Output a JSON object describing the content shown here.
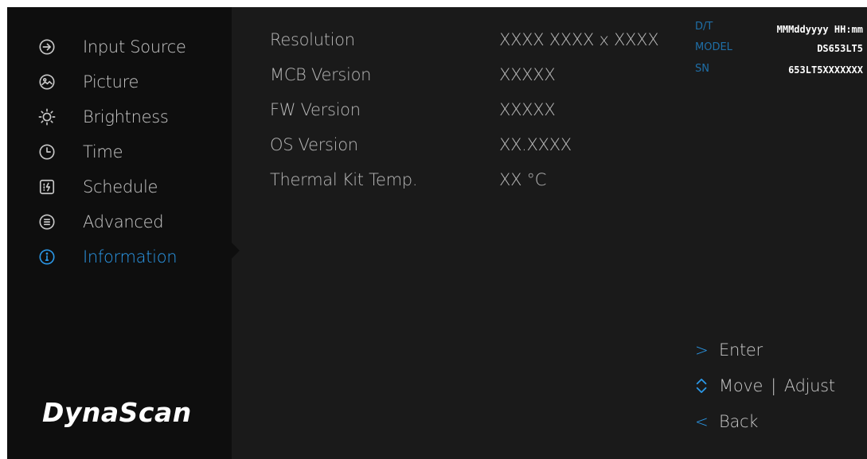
{
  "brand": {
    "logo_text": "DynaScan"
  },
  "sidebar": {
    "items": [
      {
        "label": "Input Source",
        "icon": "input-source-icon"
      },
      {
        "label": "Picture",
        "icon": "picture-icon"
      },
      {
        "label": "Brightness",
        "icon": "brightness-icon"
      },
      {
        "label": "Time",
        "icon": "clock-icon"
      },
      {
        "label": "Schedule",
        "icon": "schedule-icon"
      },
      {
        "label": "Advanced",
        "icon": "advanced-icon"
      },
      {
        "label": "Information",
        "icon": "info-icon",
        "active": true
      }
    ]
  },
  "info": {
    "rows": [
      {
        "label": "Resolution",
        "value": "XXXX  XXXX x XXXX"
      },
      {
        "label": "MCB Version",
        "value": "XXXXX"
      },
      {
        "label": "FW Version",
        "value": "XXXXX"
      },
      {
        "label": "OS Version",
        "value": "XX.XXXX"
      },
      {
        "label": "Thermal Kit Temp.",
        "value": "XX °C"
      }
    ]
  },
  "meta": {
    "dt_key": "D/T",
    "dt_value": "MMMddyyyy HH:mm",
    "model_key": "MODEL",
    "model_value": "DS653LT5",
    "sn_key": "SN",
    "sn_value": "653LT5XXXXXXX"
  },
  "nav": {
    "enter_glyph": ">",
    "enter": "Enter",
    "move": "Move",
    "separator": "|",
    "adjust": "Adjust",
    "back_glyph": "<",
    "back": "Back"
  },
  "colors": {
    "accent": "#2b97e6",
    "panel": "#1a1a1a",
    "sidebar": "#0e0e0e",
    "meta_key": "#1f6fa8"
  }
}
